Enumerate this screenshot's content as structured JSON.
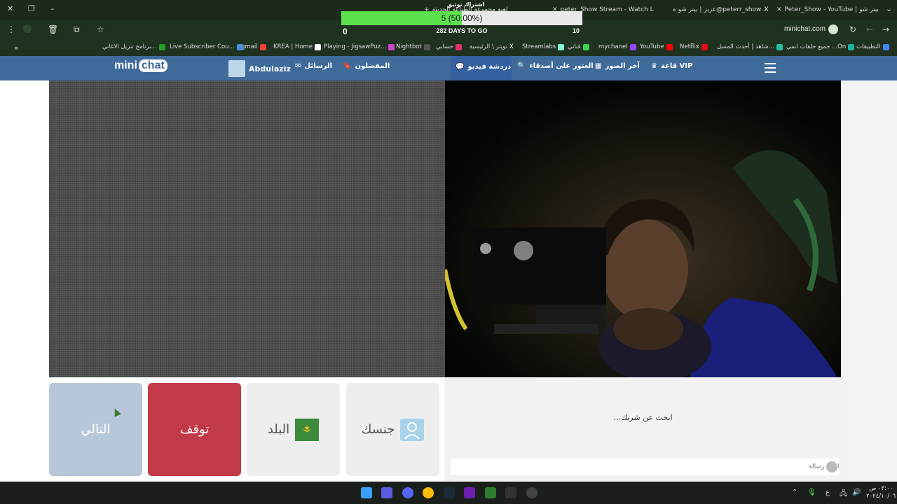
{
  "browser": {
    "tabs": [
      {
        "label": "Peter_Show - YouTube | بيتر شو",
        "color": "#e53935"
      },
      {
        "label": "عزيز | بيتر شو ه@peterr_show",
        "color": "#111111"
      },
      {
        "label": "peter_Show Stream - Watch Li",
        "color": "#39d353"
      },
      {
        "label": "لعبة مجموعة الطباعة الحديثة",
        "color": "#888888"
      }
    ],
    "active_tab_label": "اشتراك توثيق",
    "url": "minichat.com",
    "bookmarks": [
      {
        "label": "التطبيقات",
        "color": "#4285f4"
      },
      {
        "label": "جميع حلقات انمي ...On",
        "color": "#1db4a7"
      },
      {
        "label": "شاهد | أحدث المسل...",
        "color": "#22c1a4"
      },
      {
        "label": "Netflix",
        "color": "#e50914"
      },
      {
        "label": "YouTube",
        "color": "#ff0000"
      },
      {
        "label": "mychanel",
        "color": "#9146ff"
      },
      {
        "label": "قناتي",
        "color": "#39d353"
      },
      {
        "label": "Streamlabs",
        "color": "#80f5d2"
      },
      {
        "label": "تويتر \\ الرئيسية",
        "color": "#ffffff"
      },
      {
        "label": "حسابي",
        "color": "#e1306c"
      },
      {
        "label": "Nightbot",
        "color": "#555555"
      },
      {
        "label": "Playing - JigsawPuz...",
        "color": "#cc44cc"
      },
      {
        "label": "KREA | Home",
        "color": "#ffffff"
      },
      {
        "label": "gmail",
        "color": "#ea4335"
      },
      {
        "label": "Live Subscriber Cou...",
        "color": "#4a90e2"
      },
      {
        "label": "برنامج تنزيل الاغاني...",
        "color": "#20a020"
      }
    ]
  },
  "goal_widget": {
    "progress_text": "5 (50.00%)",
    "progress_fraction": 0.5,
    "min": "0",
    "max": "10",
    "days_text": "282 DAYS TO GO"
  },
  "site_nav": {
    "logo_left": "mini",
    "logo_right": "chat",
    "username": "Abdulaziz",
    "messages": "الرسائل",
    "favorites": "المفضلون",
    "video_chat": "دردشة فيديو",
    "find_friends": "العثور على أصدقاء",
    "latest_photos": "آخر الصور",
    "vip_hall": "قاعة VIP"
  },
  "controls": {
    "next": "التالي",
    "stop": "توقف",
    "country": "البلد",
    "gender": "جنسك"
  },
  "chat": {
    "searching": "...ابحث عن شريك",
    "input_placeholder": "أدخل رسالة"
  },
  "taskbar": {
    "lang": "ع",
    "time": "٠٣:٠٠ ص",
    "date": "٢٠٢٤/١٠/٠٦"
  }
}
